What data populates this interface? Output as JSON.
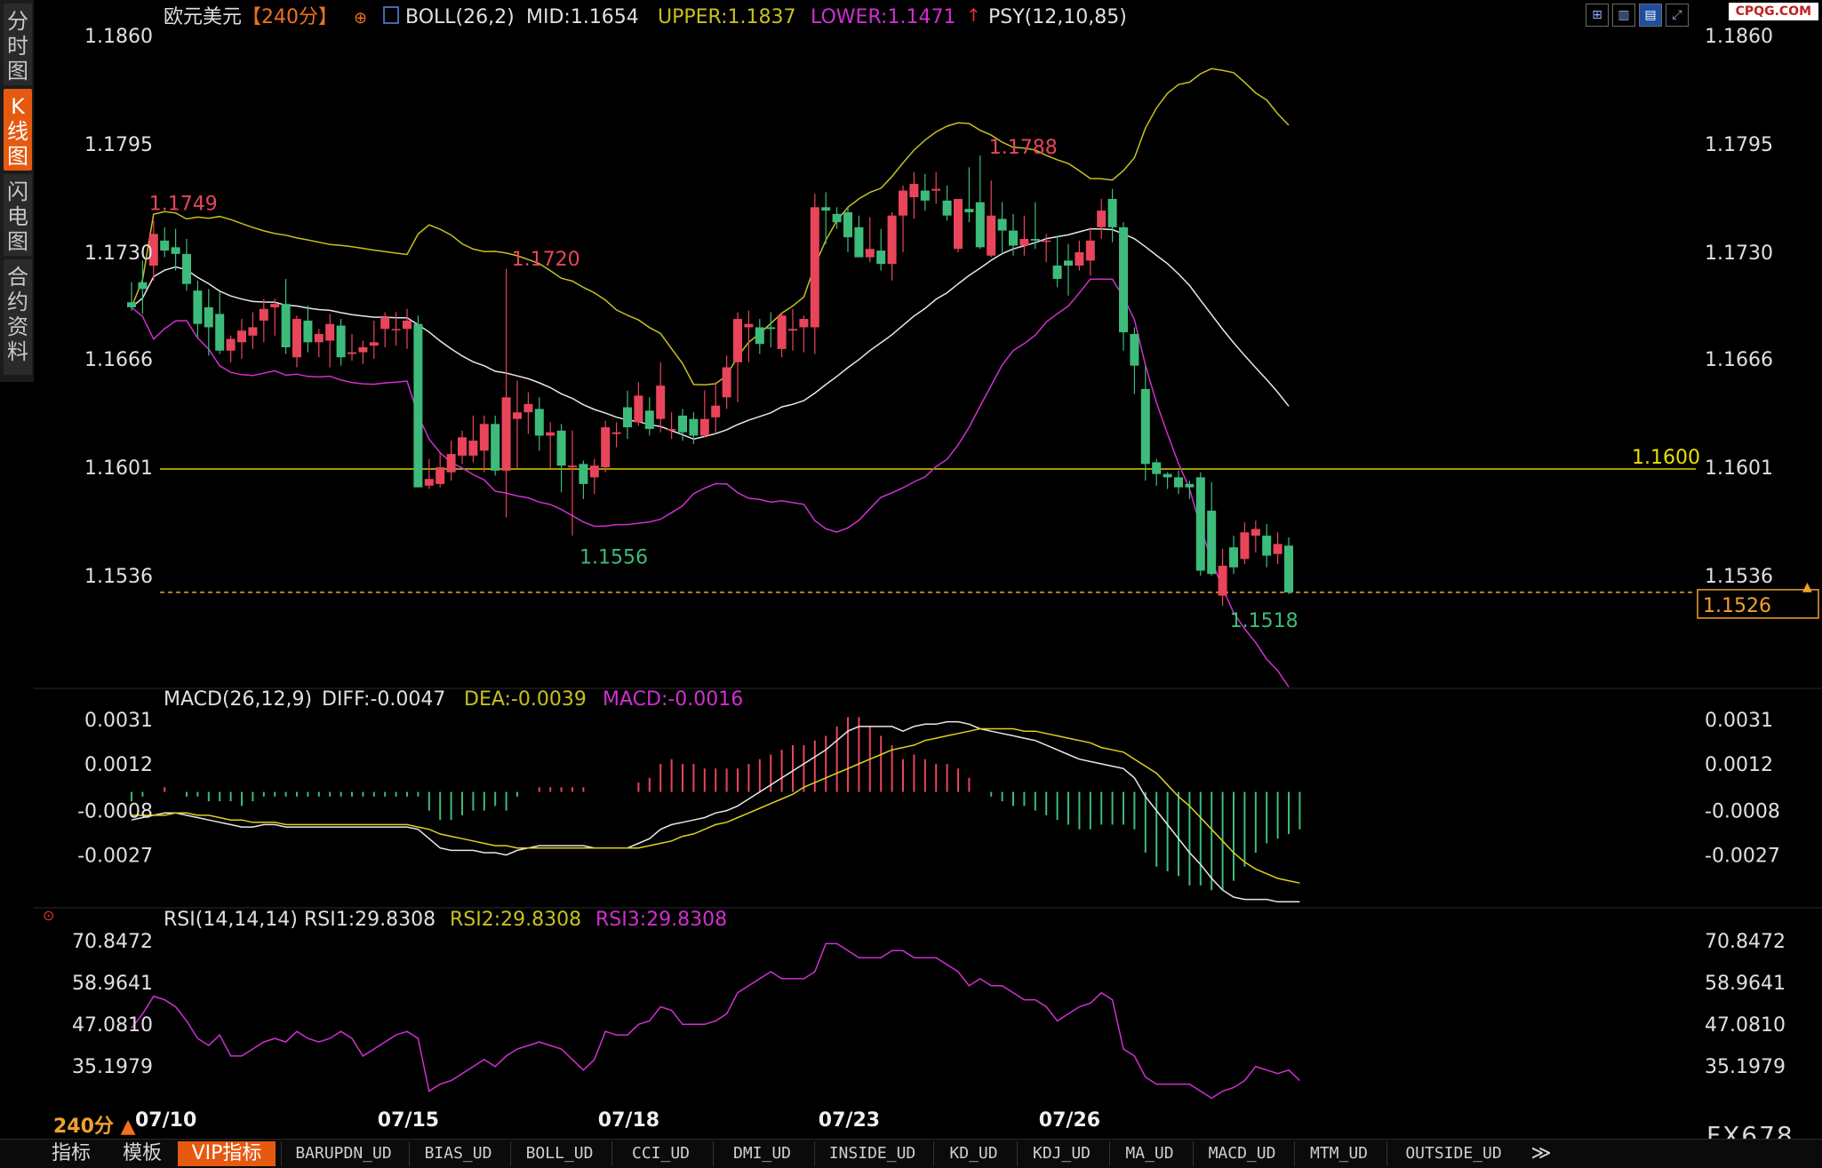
{
  "nav": {
    "tabs": [
      {
        "label": "分时图",
        "active": false
      },
      {
        "label": "K线图",
        "active": true
      },
      {
        "label": "闪电图",
        "active": false
      },
      {
        "label": "合约资料",
        "active": false
      }
    ]
  },
  "header": {
    "symbol": "欧元美元",
    "period": "【240分】",
    "boll": "BOLL(26,2)",
    "mid": "MID:1.1654",
    "upper": "UPPER:1.1837",
    "lower": "LOWER:1.1471",
    "psy": "PSY(12,10,85)"
  },
  "toolbar": {
    "icons": [
      "grid-icon",
      "candle-icon",
      "chart-select-icon",
      "fullscreen-icon"
    ],
    "brand": "CPQG.COM"
  },
  "colors": {
    "up": "#e8455a",
    "down": "#3dbb7a",
    "upper": "#c8c020",
    "mid": "#e8e8e8",
    "lower": "#d030d0",
    "price_line": "#f0a030"
  },
  "chart_data": [
    {
      "type": "candlestick",
      "title": "欧元美元",
      "y_ticks": [
        "1.1860",
        "1.1795",
        "1.1730",
        "1.1666",
        "1.1601",
        "1.1536"
      ],
      "ylim": [
        1.15,
        1.188
      ],
      "x_ticks": [
        "07/10",
        "07/15",
        "07/18",
        "07/23",
        "07/26"
      ],
      "annotations": {
        "high1": "1.1749",
        "high2": "1.1720",
        "high3": "1.1788",
        "low1": "1.1556",
        "low2": "1.1518",
        "level": "1.1600",
        "last_price": "1.1526"
      },
      "candles": [
        [
          1.17,
          1.1712,
          1.1695,
          1.1697
        ],
        [
          1.1712,
          1.1725,
          1.1693,
          1.1708
        ],
        [
          1.1722,
          1.1749,
          1.1713,
          1.1741
        ],
        [
          1.1737,
          1.1745,
          1.1727,
          1.1731
        ],
        [
          1.1733,
          1.1744,
          1.1719,
          1.1729
        ],
        [
          1.1729,
          1.1738,
          1.1707,
          1.1711
        ],
        [
          1.1707,
          1.1713,
          1.1679,
          1.1687
        ],
        [
          1.1697,
          1.1708,
          1.1668,
          1.1685
        ],
        [
          1.1693,
          1.1706,
          1.1669,
          1.1671
        ],
        [
          1.1671,
          1.168,
          1.1664,
          1.1678
        ],
        [
          1.1676,
          1.169,
          1.1666,
          1.1683
        ],
        [
          1.168,
          1.1694,
          1.1672,
          1.1685
        ],
        [
          1.1689,
          1.1702,
          1.1676,
          1.1696
        ],
        [
          1.1697,
          1.1702,
          1.168,
          1.1699
        ],
        [
          1.1699,
          1.1714,
          1.1669,
          1.1673
        ],
        [
          1.1667,
          1.1692,
          1.1661,
          1.169
        ],
        [
          1.1689,
          1.1698,
          1.167,
          1.1676
        ],
        [
          1.1676,
          1.1684,
          1.1667,
          1.1681
        ],
        [
          1.1677,
          1.1693,
          1.1661,
          1.1687
        ],
        [
          1.1686,
          1.169,
          1.1662,
          1.1667
        ],
        [
          1.1669,
          1.1681,
          1.1665,
          1.167
        ],
        [
          1.167,
          1.1677,
          1.1663,
          1.1673
        ],
        [
          1.1674,
          1.1689,
          1.1666,
          1.1676
        ],
        [
          1.1684,
          1.1694,
          1.1673,
          1.1691
        ],
        [
          1.1684,
          1.1694,
          1.1674,
          1.1684
        ],
        [
          1.1684,
          1.1696,
          1.1672,
          1.1689
        ],
        [
          1.1687,
          1.1692,
          1.1669,
          1.1589
        ],
        [
          1.159,
          1.1606,
          1.1588,
          1.1594
        ],
        [
          1.1591,
          1.161,
          1.1589,
          1.1601
        ],
        [
          1.1598,
          1.1617,
          1.1593,
          1.1609
        ],
        [
          1.1608,
          1.1623,
          1.1603,
          1.1619
        ],
        [
          1.1608,
          1.1632,
          1.1604,
          1.1617
        ],
        [
          1.1611,
          1.1632,
          1.1598,
          1.1627
        ],
        [
          1.1627,
          1.1632,
          1.1596,
          1.1599
        ],
        [
          1.1599,
          1.172,
          1.1571,
          1.1643
        ],
        [
          1.163,
          1.1653,
          1.16,
          1.1634
        ],
        [
          1.1634,
          1.1646,
          1.1621,
          1.1639
        ],
        [
          1.1636,
          1.1643,
          1.1611,
          1.162
        ],
        [
          1.162,
          1.1628,
          1.16,
          1.1622
        ],
        [
          1.1623,
          1.1627,
          1.1586,
          1.1602
        ],
        [
          1.1601,
          1.1623,
          1.156,
          1.1602
        ],
        [
          1.1603,
          1.1605,
          1.1582,
          1.1591
        ],
        [
          1.1595,
          1.1606,
          1.1585,
          1.1602
        ],
        [
          1.1601,
          1.1629,
          1.1598,
          1.1625
        ],
        [
          1.1621,
          1.1628,
          1.1613,
          1.1622
        ],
        [
          1.1637,
          1.1647,
          1.1618,
          1.1625
        ],
        [
          1.1628,
          1.1652,
          1.1626,
          1.1644
        ],
        [
          1.1635,
          1.1643,
          1.162,
          1.1624
        ],
        [
          1.163,
          1.1664,
          1.1622,
          1.165
        ],
        [
          1.1624,
          1.1634,
          1.1618,
          1.1624
        ],
        [
          1.1632,
          1.1636,
          1.1617,
          1.1622
        ],
        [
          1.163,
          1.1634,
          1.1615,
          1.162
        ],
        [
          1.162,
          1.1647,
          1.1619,
          1.163
        ],
        [
          1.1631,
          1.1652,
          1.1622,
          1.1638
        ],
        [
          1.1643,
          1.1668,
          1.1636,
          1.1661
        ],
        [
          1.1664,
          1.1694,
          1.164,
          1.169
        ],
        [
          1.1685,
          1.1695,
          1.1664,
          1.1687
        ],
        [
          1.1685,
          1.169,
          1.1669,
          1.1675
        ],
        [
          1.1685,
          1.1694,
          1.1673,
          1.1684
        ],
        [
          1.1672,
          1.1694,
          1.1667,
          1.1692
        ],
        [
          1.1683,
          1.1696,
          1.1671,
          1.1684
        ],
        [
          1.1685,
          1.1692,
          1.167,
          1.169
        ],
        [
          1.1685,
          1.1765,
          1.1669,
          1.1757
        ],
        [
          1.1757,
          1.1766,
          1.1735,
          1.1755
        ],
        [
          1.1753,
          1.1757,
          1.1744,
          1.1748
        ],
        [
          1.1754,
          1.1757,
          1.173,
          1.1739
        ],
        [
          1.1745,
          1.1752,
          1.1737,
          1.1727
        ],
        [
          1.1727,
          1.1751,
          1.1724,
          1.1732
        ],
        [
          1.1731,
          1.1744,
          1.1719,
          1.1723
        ],
        [
          1.1723,
          1.1754,
          1.1713,
          1.1752
        ],
        [
          1.1752,
          1.177,
          1.173,
          1.1767
        ],
        [
          1.1763,
          1.1778,
          1.175,
          1.1771
        ],
        [
          1.1767,
          1.1777,
          1.1755,
          1.1761
        ],
        [
          1.1767,
          1.1778,
          1.1759,
          1.1768
        ],
        [
          1.1761,
          1.177,
          1.1749,
          1.1752
        ],
        [
          1.1732,
          1.1758,
          1.173,
          1.1762
        ],
        [
          1.1756,
          1.1781,
          1.1748,
          1.1754
        ],
        [
          1.176,
          1.1788,
          1.1732,
          1.1733
        ],
        [
          1.1728,
          1.1773,
          1.1727,
          1.1752
        ],
        [
          1.175,
          1.176,
          1.173,
          1.1743
        ],
        [
          1.1743,
          1.1753,
          1.1728,
          1.1734
        ],
        [
          1.1734,
          1.1752,
          1.1728,
          1.1738
        ],
        [
          1.1738,
          1.176,
          1.1732,
          1.1737
        ],
        [
          1.1737,
          1.1741,
          1.1724,
          1.1737
        ],
        [
          1.1722,
          1.174,
          1.1709,
          1.1714
        ],
        [
          1.1725,
          1.1735,
          1.1704,
          1.1722
        ],
        [
          1.1722,
          1.1737,
          1.1719,
          1.173
        ],
        [
          1.1725,
          1.1745,
          1.1716,
          1.1737
        ],
        [
          1.1745,
          1.1762,
          1.1738,
          1.1755
        ],
        [
          1.1762,
          1.1768,
          1.1736,
          1.1745
        ],
        [
          1.1745,
          1.1748,
          1.1671,
          1.1682
        ],
        [
          1.1681,
          1.1685,
          1.1645,
          1.1662
        ],
        [
          1.1648,
          1.1662,
          1.1593,
          1.1603
        ],
        [
          1.1604,
          1.1606,
          1.159,
          1.1597
        ],
        [
          1.1597,
          1.1598,
          1.1588,
          1.1595
        ],
        [
          1.1595,
          1.1599,
          1.1585,
          1.1589
        ],
        [
          1.1591,
          1.1593,
          1.1582,
          1.1589
        ],
        [
          1.1595,
          1.1598,
          1.1536,
          1.1539
        ],
        [
          1.1575,
          1.1592,
          1.1536,
          1.1537
        ],
        [
          1.1524,
          1.1552,
          1.1518,
          1.1542
        ],
        [
          1.1553,
          1.156,
          1.1537,
          1.1541
        ],
        [
          1.1546,
          1.1568,
          1.1543,
          1.1562
        ],
        [
          1.156,
          1.1569,
          1.155,
          1.1564
        ],
        [
          1.156,
          1.1567,
          1.1541,
          1.1548
        ],
        [
          1.1549,
          1.1562,
          1.1543,
          1.1555
        ],
        [
          1.1554,
          1.1559,
          1.1525,
          1.1526
        ]
      ]
    },
    {
      "type": "line",
      "title": "MACD(26,12,9)",
      "legend": [
        "DIFF:-0.0047",
        "DEA:-0.0039",
        "MACD:-0.0016"
      ],
      "y_ticks": [
        "0.0031",
        "0.0012",
        "-0.0008",
        "-0.0027"
      ],
      "ylim": [
        -0.005,
        0.0034
      ],
      "diff": [
        -0.0012,
        -0.0011,
        -0.001,
        -0.0009,
        -0.0009,
        -0.001,
        -0.0011,
        -0.0012,
        -0.0013,
        -0.0014,
        -0.0015,
        -0.0015,
        -0.0014,
        -0.0014,
        -0.0015,
        -0.0015,
        -0.0015,
        -0.0015,
        -0.0015,
        -0.0015,
        -0.0015,
        -0.0015,
        -0.0015,
        -0.0015,
        -0.0015,
        -0.0015,
        -0.0016,
        -0.002,
        -0.0024,
        -0.0025,
        -0.0025,
        -0.0025,
        -0.0026,
        -0.0026,
        -0.0027,
        -0.0025,
        -0.0024,
        -0.0023,
        -0.0023,
        -0.0023,
        -0.0023,
        -0.0023,
        -0.0024,
        -0.0024,
        -0.0024,
        -0.0024,
        -0.0022,
        -0.002,
        -0.0016,
        -0.0014,
        -0.0013,
        -0.0012,
        -0.0011,
        -0.0009,
        -0.0008,
        -0.0006,
        -0.0003,
        0.0,
        0.0003,
        0.0006,
        0.0009,
        0.0012,
        0.0015,
        0.0018,
        0.0022,
        0.0026,
        0.0028,
        0.0028,
        0.0028,
        0.0028,
        0.0026,
        0.0028,
        0.0029,
        0.0029,
        0.003,
        0.003,
        0.0029,
        0.0027,
        0.0026,
        0.0025,
        0.0024,
        0.0023,
        0.0022,
        0.002,
        0.0018,
        0.0016,
        0.0014,
        0.0013,
        0.0012,
        0.0011,
        0.001,
        0.0006,
        -0.0002,
        -0.0008,
        -0.0014,
        -0.002,
        -0.0026,
        -0.0031,
        -0.0037,
        -0.0042,
        -0.0045,
        -0.0046,
        -0.0046,
        -0.0046,
        -0.0047,
        -0.0047,
        -0.0047
      ],
      "dea": [
        -0.001,
        -0.001,
        -0.001,
        -0.001,
        -0.0009,
        -0.0009,
        -0.001,
        -0.001,
        -0.0011,
        -0.0012,
        -0.0012,
        -0.0013,
        -0.0013,
        -0.0013,
        -0.0014,
        -0.0014,
        -0.0014,
        -0.0014,
        -0.0014,
        -0.0014,
        -0.0014,
        -0.0014,
        -0.0014,
        -0.0014,
        -0.0014,
        -0.0014,
        -0.0015,
        -0.0016,
        -0.0018,
        -0.0019,
        -0.002,
        -0.0021,
        -0.0022,
        -0.0023,
        -0.0023,
        -0.0024,
        -0.0024,
        -0.0024,
        -0.0024,
        -0.0024,
        -0.0024,
        -0.0024,
        -0.0024,
        -0.0024,
        -0.0024,
        -0.0024,
        -0.0024,
        -0.0023,
        -0.0022,
        -0.0021,
        -0.0019,
        -0.0018,
        -0.0016,
        -0.0014,
        -0.0013,
        -0.0011,
        -0.0009,
        -0.0007,
        -0.0005,
        -0.0003,
        -0.0001,
        0.0002,
        0.0004,
        0.0006,
        0.0008,
        0.001,
        0.0012,
        0.0014,
        0.0016,
        0.0018,
        0.0019,
        0.002,
        0.0022,
        0.0023,
        0.0024,
        0.0025,
        0.0026,
        0.0027,
        0.0027,
        0.0027,
        0.0027,
        0.0026,
        0.0026,
        0.0025,
        0.0024,
        0.0023,
        0.0022,
        0.0021,
        0.0019,
        0.0018,
        0.0017,
        0.0014,
        0.0011,
        0.0008,
        0.0003,
        -0.0002,
        -0.0006,
        -0.0011,
        -0.0016,
        -0.0021,
        -0.0026,
        -0.003,
        -0.0033,
        -0.0035,
        -0.0037,
        -0.0038,
        -0.0039
      ]
    },
    {
      "type": "line",
      "title": "RSI(14,14,14)",
      "legend": [
        "RSI1:29.8308",
        "RSI2:29.8308",
        "RSI3:29.8308"
      ],
      "y_ticks": [
        "70.8472",
        "58.9641",
        "47.0810",
        "35.1979"
      ],
      "ylim": [
        23,
        73
      ],
      "values": [
        46,
        50,
        55,
        54,
        52,
        48,
        43,
        41,
        44,
        38,
        38,
        40,
        42,
        43,
        42,
        45,
        43,
        42,
        43,
        45,
        43,
        38,
        40,
        42,
        44,
        45,
        43,
        28,
        30,
        31,
        33,
        35,
        37,
        35,
        38,
        40,
        41,
        42,
        41,
        40,
        37,
        34,
        37,
        45,
        44,
        44,
        47,
        48,
        52,
        51,
        47,
        47,
        47,
        48,
        50,
        56,
        58,
        60,
        62,
        60,
        60,
        60,
        62,
        70,
        70,
        68,
        66,
        66,
        66,
        68,
        68,
        66,
        66,
        66,
        64,
        62,
        58,
        60,
        58,
        58,
        56,
        54,
        54,
        52,
        48,
        50,
        52,
        53,
        56,
        54,
        40,
        38,
        32,
        30,
        30,
        30,
        30,
        28,
        26,
        28,
        29,
        31,
        35,
        34,
        33,
        34,
        31
      ]
    }
  ],
  "periodLabel": "240分",
  "bottom_tabs": [
    "指标",
    "模板",
    "VIP指标",
    "BARUPDN_UD",
    "BIAS_UD",
    "BOLL_UD",
    "CCI_UD",
    "DMI_UD",
    "INSIDE_UD",
    "KD_UD",
    "KDJ_UD",
    "MA_UD",
    "MACD_UD",
    "MTM_UD",
    "OUTSIDE_UD",
    "≫"
  ],
  "watermark": "FX678"
}
